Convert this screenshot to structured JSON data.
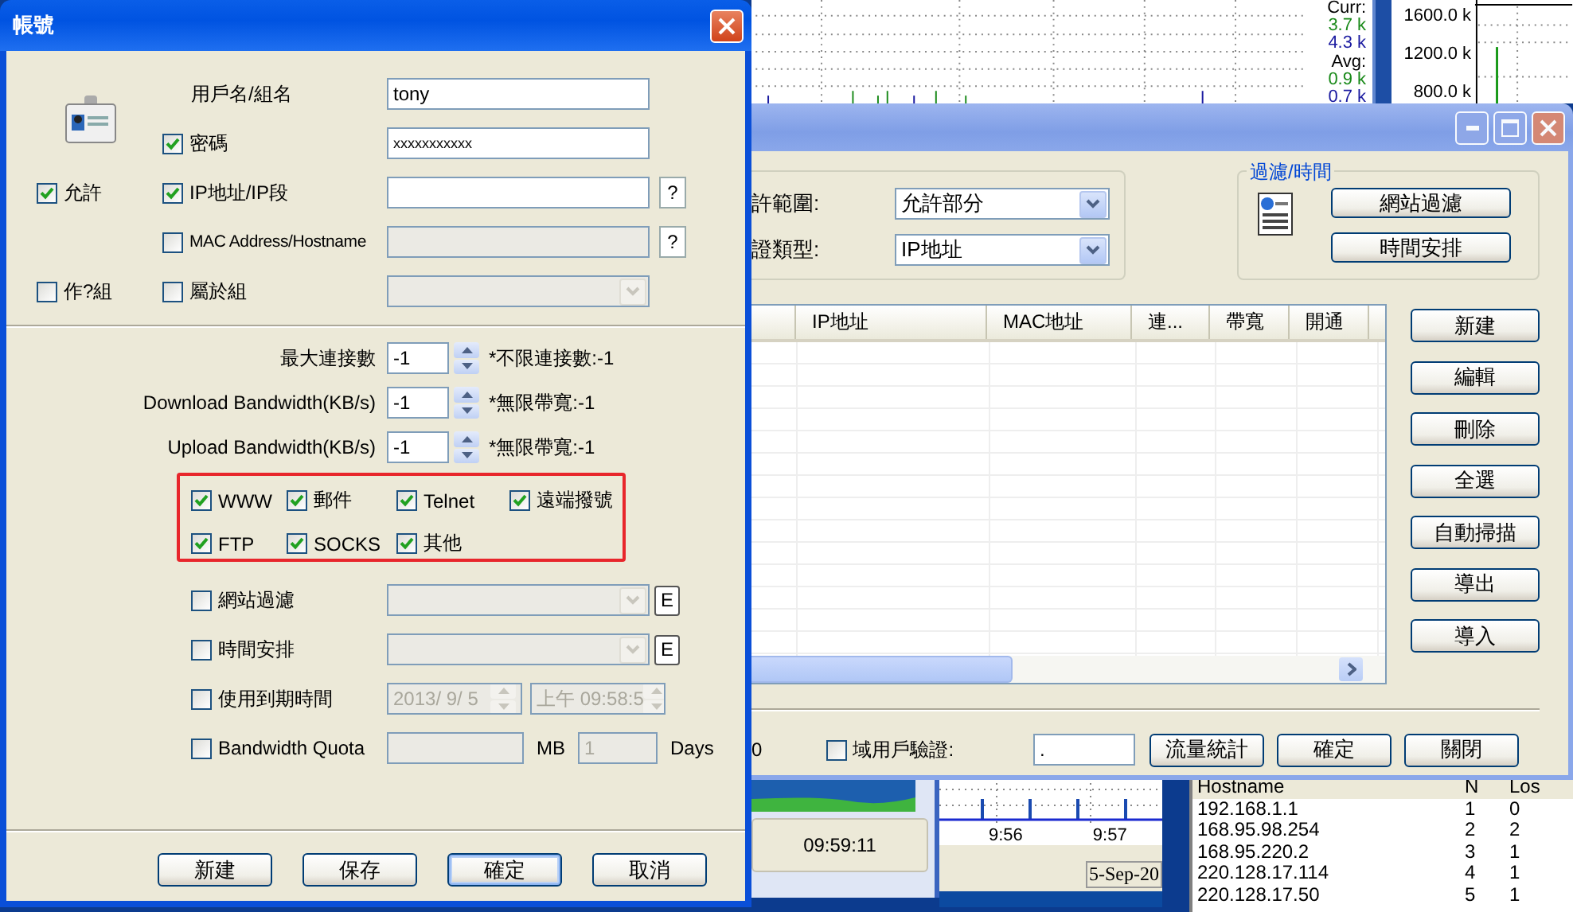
{
  "monitor": {
    "stats": [
      {
        "kind": "label",
        "text": "Curr:"
      },
      {
        "kind": "value",
        "text": "3.7 k",
        "color": "#1a8a1a"
      },
      {
        "kind": "value",
        "text": "4.3 k",
        "color": "#1a1aa0"
      },
      {
        "kind": "label",
        "text": "Avg:"
      },
      {
        "kind": "value",
        "text": "0.9 k",
        "color": "#1a8a1a"
      },
      {
        "kind": "value",
        "text": "0.7 k",
        "color": "#1a1aa0"
      }
    ],
    "y_axis": [
      "1600.0 k",
      "1200.0 k",
      "800.0 k"
    ]
  },
  "status_panel": {
    "clock": "09:59:11",
    "ticks": [
      "9:56",
      "9:57"
    ],
    "date": "5-Sep-20",
    "hosts": {
      "columns": [
        "Hostname",
        "N",
        "Los"
      ],
      "rows": [
        [
          "192.168.1.1",
          "1",
          "0"
        ],
        [
          "168.95.98.254",
          "2",
          "2"
        ],
        [
          "168.95.220.2",
          "3",
          "1"
        ],
        [
          "220.128.17.114",
          "4",
          "1"
        ],
        [
          "220.128.17.50",
          "5",
          "1"
        ]
      ]
    }
  },
  "users_window": {
    "scope": {
      "label": "許範圍:",
      "value": "允許部分"
    },
    "auth_type": {
      "label": "證類型:",
      "value": "IP地址"
    },
    "filter_group": {
      "title": "過濾/時間",
      "buttons": [
        "網站過濾",
        "時間安排"
      ]
    },
    "table": {
      "columns": [
        "IP地址",
        "MAC地址",
        "連...",
        "帶寬",
        "開通"
      ]
    },
    "side_buttons": [
      "新建",
      "編輯",
      "刪除",
      "全選",
      "自動掃描",
      "導出",
      "導入"
    ],
    "left_fragment": "0",
    "domain_auth": {
      "label": "域用戶驗證:",
      "checked": false
    },
    "domain_value": ".",
    "buttons": [
      "流量統計",
      "確定",
      "關閉"
    ]
  },
  "account_dialog": {
    "title": "帳號",
    "username": {
      "label": "用戶名/組名",
      "value": "tony"
    },
    "password": {
      "label": "密碼",
      "checked": true,
      "value": "xxxxxxxxxxx"
    },
    "allow": {
      "label": "允許",
      "checked": true
    },
    "ip": {
      "label": "IP地址/IP段",
      "checked": true,
      "help": "?"
    },
    "mac": {
      "label": "MAC Address/Hostname",
      "checked": false,
      "help": "?"
    },
    "as_group": {
      "label": "作?組",
      "checked": false
    },
    "member_of": {
      "label": "屬於組",
      "checked": false
    },
    "limits": [
      {
        "label": "最大連接數",
        "value": "-1",
        "note": "*不限連接數:-1"
      },
      {
        "label": "Download Bandwidth(KB/s)",
        "value": "-1",
        "note": "*無限帶寬:-1"
      },
      {
        "label": "Upload Bandwidth(KB/s)",
        "value": "-1",
        "note": "*無限帶寬:-1"
      }
    ],
    "services": [
      {
        "label": "WWW",
        "checked": true
      },
      {
        "label": "郵件",
        "checked": true
      },
      {
        "label": "Telnet",
        "checked": true
      },
      {
        "label": "遠端撥號",
        "checked": true
      },
      {
        "label": "FTP",
        "checked": true
      },
      {
        "label": "SOCKS",
        "checked": true
      },
      {
        "label": "其他",
        "checked": true
      }
    ],
    "website_filter": {
      "label": "網站過濾",
      "checked": false,
      "edit": "E"
    },
    "schedule": {
      "label": "時間安排",
      "checked": false,
      "edit": "E"
    },
    "expiry": {
      "label": "使用到期時間",
      "checked": false,
      "date": "2013/ 9/ 5",
      "time": "上午 09:58:5"
    },
    "quota": {
      "label": "Bandwidth Quota",
      "checked": false,
      "unit": "MB",
      "days": "1",
      "days_unit": "Days"
    },
    "buttons": [
      {
        "label": "新建",
        "default": false
      },
      {
        "label": "保存",
        "default": false
      },
      {
        "label": "確定",
        "default": true
      },
      {
        "label": "取消",
        "default": false
      }
    ]
  }
}
